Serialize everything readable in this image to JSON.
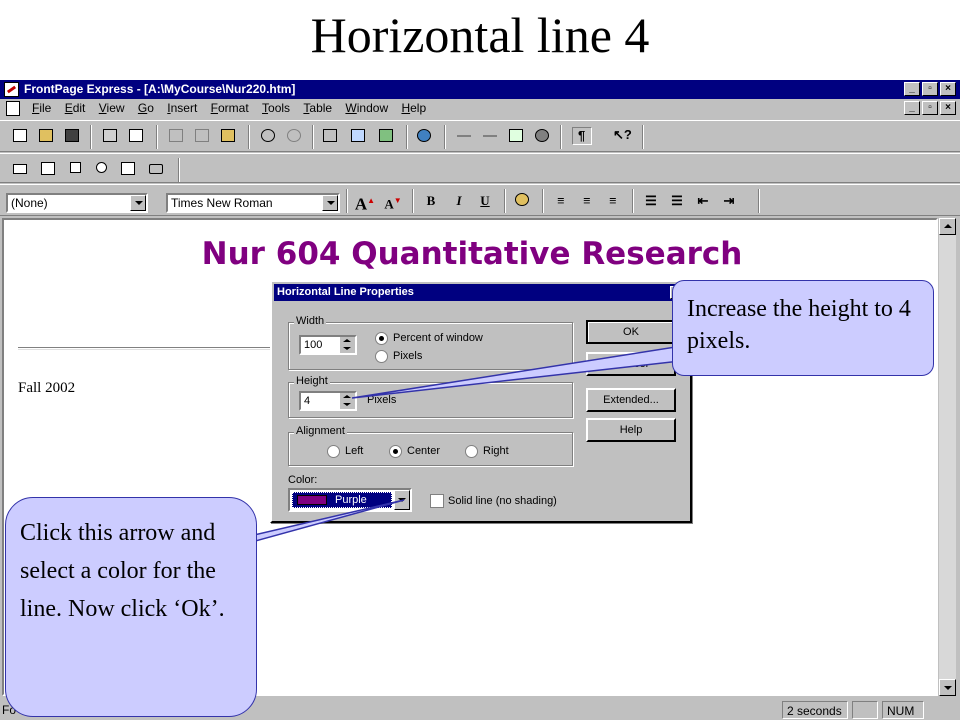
{
  "slide": {
    "title": "Horizontal line 4"
  },
  "window": {
    "title": "FrontPage Express - [A:\\MyCourse\\Nur220.htm]"
  },
  "menubar": {
    "items": [
      "File",
      "Edit",
      "View",
      "Go",
      "Insert",
      "Format",
      "Tools",
      "Table",
      "Window",
      "Help"
    ]
  },
  "format_toolbar": {
    "style_value": "(None)",
    "font_value": "Times New Roman"
  },
  "document": {
    "heading": "Nur 604 Quantitative Research",
    "body_text": "Fall 2002",
    "heading_color": "#800080"
  },
  "dialog": {
    "title": "Horizontal Line Properties",
    "width_group": "Width",
    "width_value": "100",
    "width_percent": "Percent of window",
    "width_pixels": "Pixels",
    "height_group": "Height",
    "height_value": "4",
    "height_unit": "Pixels",
    "alignment_group": "Alignment",
    "align_left": "Left",
    "align_center": "Center",
    "align_right": "Right",
    "color_label": "Color:",
    "color_value": "Purple",
    "solid_line": "Solid line (no shading)",
    "ok": "OK",
    "cancel": "Cancel",
    "extended": "Extended...",
    "help": "Help"
  },
  "statusbar": {
    "left_text": "Fo",
    "time": "2 seconds",
    "num": "NUM"
  },
  "callouts": {
    "top": "Increase the height to 4 pixels.",
    "bottom": "Click this arrow and select a color for the line. Now click ‘Ok’."
  }
}
